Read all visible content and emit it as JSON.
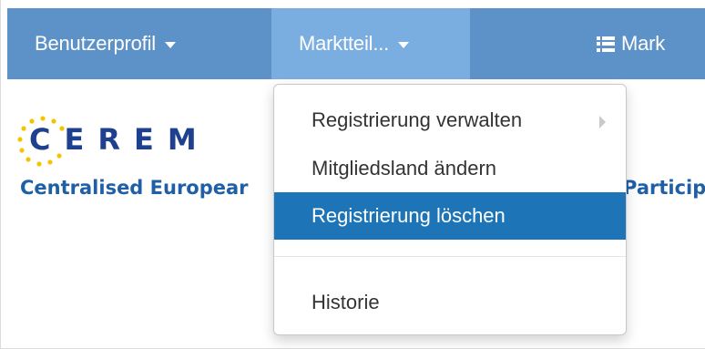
{
  "navbar": {
    "profile_label": "Benutzerprofil",
    "market_label": "Marktteil...",
    "third_label": "Mark",
    "third_icon": "list-icon"
  },
  "logo": {
    "letters": "CEREM",
    "subtitle_left": "Centralised Europear",
    "subtitle_right": "Particip"
  },
  "dropdown": {
    "items": [
      {
        "label": "Registrierung verwalten",
        "has_submenu": true
      },
      {
        "label": "Mitgliedsland ändern"
      },
      {
        "label": "Registrierung löschen",
        "active": true
      },
      {
        "label": "Historie"
      }
    ]
  },
  "colors": {
    "navbar": "#5d92c8",
    "navbar_active": "#7aaee0",
    "menu_active": "#1d74b6",
    "logo_blue": "#1f3f8f",
    "logo_star": "#f5c400"
  }
}
